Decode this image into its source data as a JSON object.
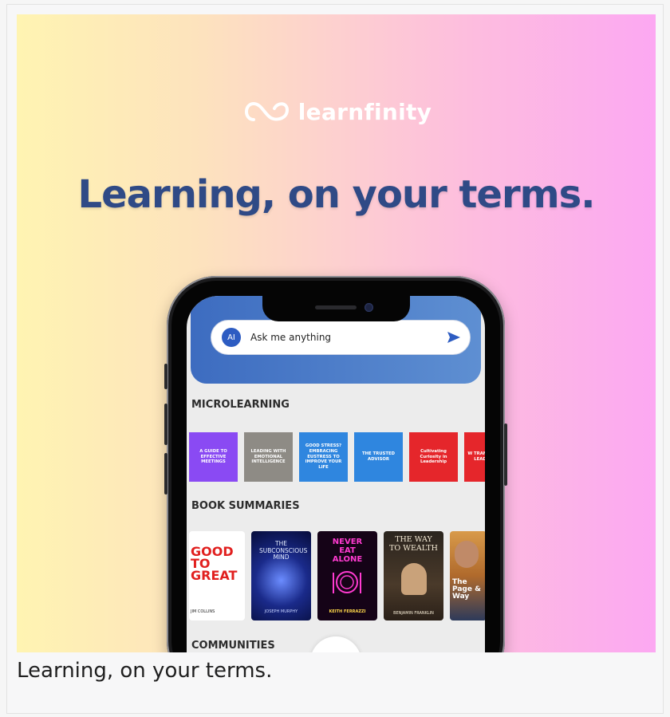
{
  "brand": {
    "name": "learnfinity",
    "logo_icon": "infinity-loop-icon"
  },
  "headline": "Learning, on your terms.",
  "caption": "Learning, on your terms.",
  "app": {
    "search": {
      "badge": "AI",
      "placeholder": "Ask me anything",
      "send_icon": "send-arrow-icon"
    },
    "sections": {
      "microlearning": "MICROLEARNING",
      "book_summaries": "BOOK SUMMARIES",
      "communities": "COMMUNITIES"
    },
    "microlearning_cards": [
      {
        "title": "A GUIDE TO EFFECTIVE MEETINGS",
        "color": "#8a4af3"
      },
      {
        "title": "LEADING WITH EMOTIONAL INTELLIGENCE",
        "color": "#8e8b85"
      },
      {
        "title": "GOOD STRESS? EMBRACING EUSTRESS TO IMPROVE YOUR LIFE",
        "color": "#2f86df"
      },
      {
        "title": "THE TRUSTED ADVISOR",
        "color": "#2f86df"
      },
      {
        "title": "Cultivating Curiosity in Leadership",
        "color": "#e5262b"
      },
      {
        "title": "W TRANSF LEAD",
        "color": "#e5262b"
      }
    ],
    "books": [
      {
        "title": "GOOD TO GREAT",
        "author": "JIM COLLINS"
      },
      {
        "title": "THE SUBCONSCIOUS MIND",
        "author": "JOSEPH MURPHY"
      },
      {
        "title": "NEVER EAT ALONE",
        "author": "KEITH FERRAZZI"
      },
      {
        "title": "THE WAY TO WEALTH",
        "author": "BENJAMIN FRANKLIN"
      },
      {
        "title": "The Page & Way",
        "author": ""
      }
    ]
  },
  "colors": {
    "headline": "#2f4a86",
    "app_header": "#3d6cc0",
    "accent_blue": "#2d5cc2"
  }
}
